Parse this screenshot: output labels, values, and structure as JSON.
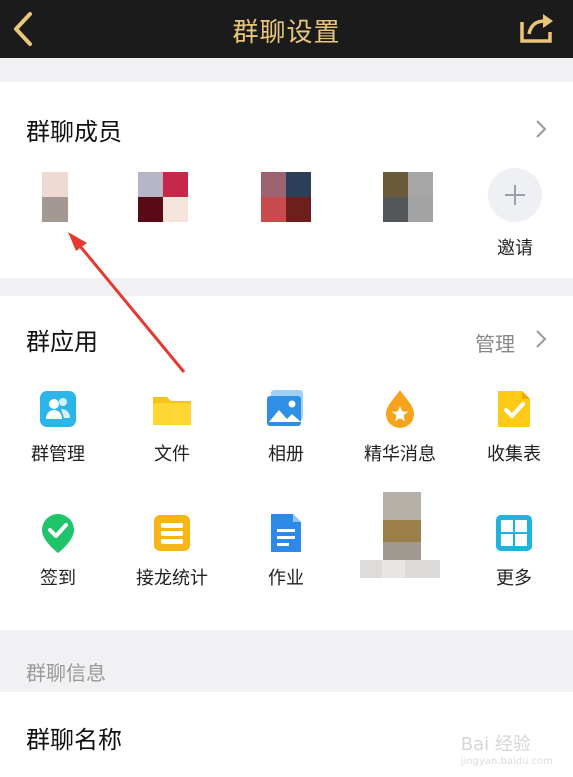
{
  "header": {
    "title": "群聊设置",
    "back_icon": "chevron-left-icon",
    "share_icon": "share-icon",
    "title_color": "#e8c77a"
  },
  "members": {
    "title": "群聊成员",
    "invite_label": "邀请",
    "avatars": [
      {
        "colors": [
          "#efdad3",
          "#efdad3",
          "#a39894",
          "#a39894"
        ]
      },
      {
        "colors": [
          "#b7b5c8",
          "#c6284a",
          "#5a0a14",
          "#f4e4dc"
        ]
      },
      {
        "colors": [
          "#9b6470",
          "#2c3f58",
          "#c84b4e",
          "#6e1f1c"
        ]
      },
      {
        "colors": [
          "#6b5a3c",
          "#a7a7a7",
          "#54575a",
          "#a3a3a3"
        ]
      }
    ]
  },
  "apps": {
    "title": "群应用",
    "manage_label": "管理",
    "items": [
      {
        "label": "群管理",
        "icon": "group-admin-icon"
      },
      {
        "label": "文件",
        "icon": "folder-icon"
      },
      {
        "label": "相册",
        "icon": "photo-album-icon"
      },
      {
        "label": "精华消息",
        "icon": "essence-drop-icon"
      },
      {
        "label": "收集表",
        "icon": "collection-form-icon"
      },
      {
        "label": "签到",
        "icon": "check-in-icon"
      },
      {
        "label": "接龙统计",
        "icon": "relay-stats-icon"
      },
      {
        "label": "作业",
        "icon": "homework-icon"
      },
      {
        "label": "",
        "icon": "blurred-app-icon"
      },
      {
        "label": "更多",
        "icon": "more-grid-icon"
      }
    ]
  },
  "info": {
    "section_title": "群聊信息",
    "name_label": "群聊名称"
  },
  "watermark": {
    "text": "Bai 经验",
    "sub": "jingyan.baidu.com"
  }
}
